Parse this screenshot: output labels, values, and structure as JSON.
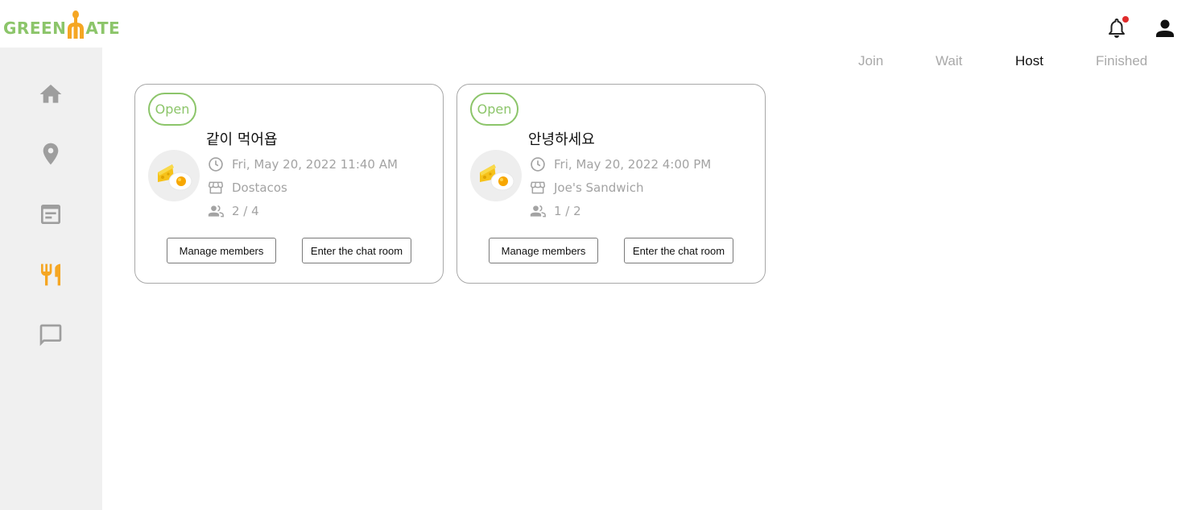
{
  "brand": {
    "left": "GREEN",
    "right": "ATE",
    "accent": "#8cc56a",
    "fork_color": "#f5a623"
  },
  "header": {
    "notification_icon": "bell-icon",
    "profile_icon": "user-icon",
    "has_notification": true
  },
  "sidebar": {
    "items": [
      {
        "icon": "home-icon",
        "active": false
      },
      {
        "icon": "location-pin-icon",
        "active": false
      },
      {
        "icon": "article-icon",
        "active": false
      },
      {
        "icon": "restaurant-icon",
        "active": true
      },
      {
        "icon": "chat-icon",
        "active": false
      }
    ],
    "active_color": "#f5a623",
    "inactive_color": "#9e9e9e"
  },
  "tabs": [
    {
      "label": "Join",
      "active": false
    },
    {
      "label": "Wait",
      "active": false
    },
    {
      "label": "Host",
      "active": true
    },
    {
      "label": "Finished",
      "active": false
    }
  ],
  "cards": [
    {
      "status": "Open",
      "title": "같이 먹어욥",
      "date": "Fri, May 20, 2022 11:40 AM",
      "place": "Dostacos",
      "members": "2 / 4",
      "manage_label": "Manage members",
      "chat_label": "Enter the chat room"
    },
    {
      "status": "Open",
      "title": "안녕하세요",
      "date": "Fri, May 20, 2022 4:00 PM",
      "place": "Joe's Sandwich",
      "members": "1 / 2",
      "manage_label": "Manage members",
      "chat_label": "Enter the chat room"
    }
  ]
}
